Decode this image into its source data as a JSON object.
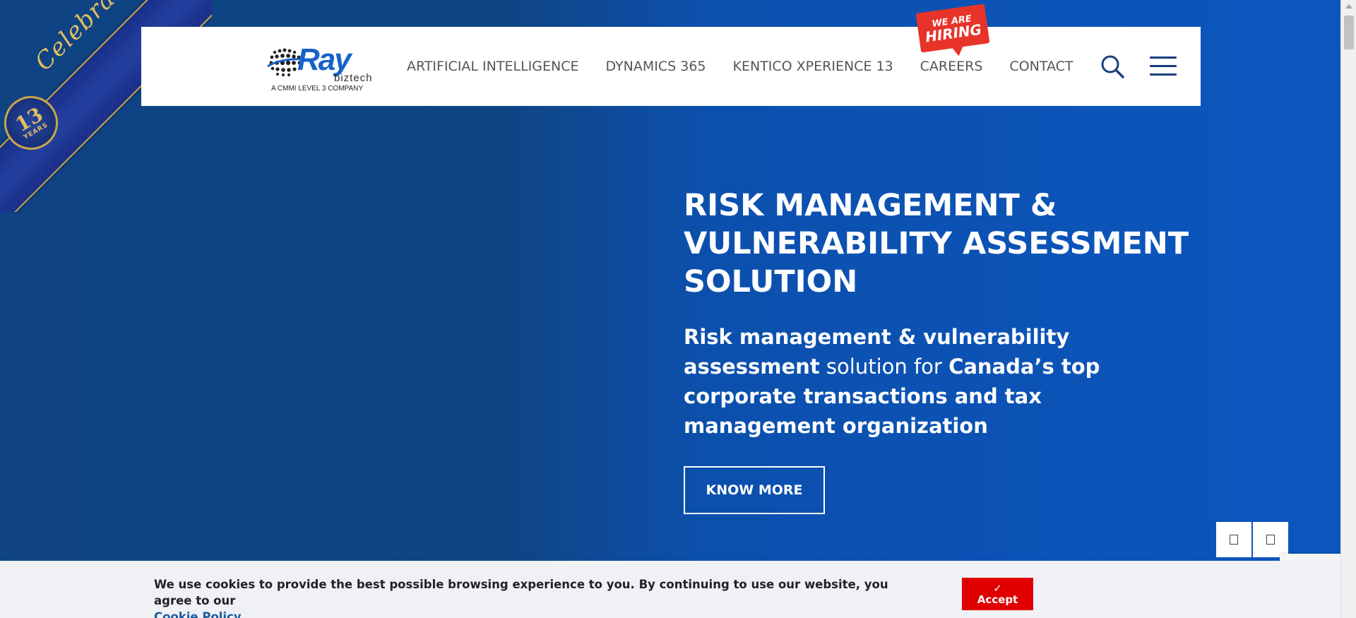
{
  "ribbon": {
    "text": "Celebrations",
    "badge_number": "13",
    "badge_label": "YEARS"
  },
  "logo": {
    "word": "Ray",
    "sub": "biztech",
    "tagline": "A CMMI LEVEL 3 COMPANY"
  },
  "nav": {
    "items": [
      {
        "label": "ARTIFICIAL INTELLIGENCE"
      },
      {
        "label": "DYNAMICS 365"
      },
      {
        "label": "KENTICO XPERIENCE 13"
      },
      {
        "label": "CAREERS"
      },
      {
        "label": "CONTACT"
      }
    ],
    "hiring_badge": {
      "line1": "WE ARE",
      "line2": "HIRING"
    }
  },
  "hero": {
    "title": "RISK MANAGEMENT & VULNERABILITY ASSESSMENT SOLUTION",
    "desc_part1": "Risk management & vulnerability assessment",
    "desc_part2": " solution for ",
    "desc_part3": "Canada’s top corporate transactions and tax management organization",
    "cta_label": "KNOW MORE"
  },
  "cookie": {
    "text": "We use cookies to provide the best possible browsing experience to you. By continuing to use our website, you agree to our",
    "link_label": "Cookie Policy",
    "accept_check": "✓",
    "accept_label": "Accept"
  },
  "colors": {
    "hero_bg_left": "#0f4383",
    "hero_bg_right": "#0b56bf",
    "logo_blue": "#1762c9",
    "hiring_red": "#e8332a",
    "accept_red": "#e00000",
    "link_blue": "#1a5aa0"
  },
  "icons": {
    "search": "search-icon",
    "menu": "hamburger-menu-icon"
  }
}
